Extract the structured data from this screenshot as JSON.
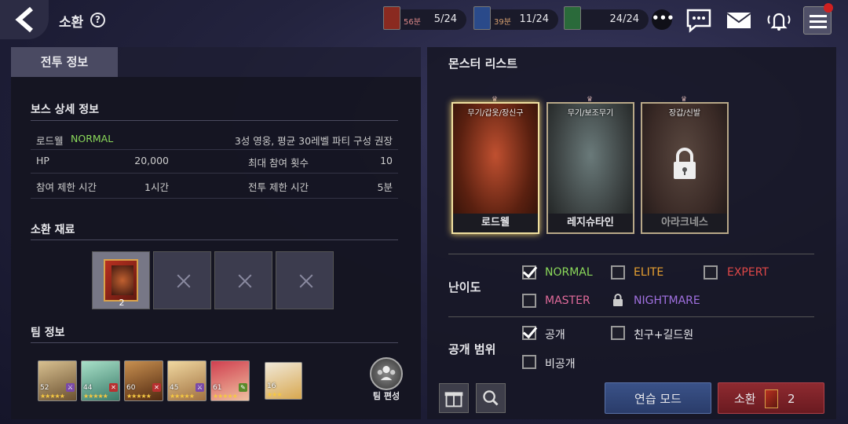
{
  "header": {
    "title": "소환",
    "help": "?"
  },
  "resources": [
    {
      "tag": "56분",
      "value": "5/24",
      "color": "#8a2a20"
    },
    {
      "tag": "39분",
      "value": "11/24",
      "color": "#2a4a8a"
    },
    {
      "tag": "",
      "value": "24/24",
      "color": "#2a6a3a"
    }
  ],
  "more_label": "•••",
  "battle_tab": "전투 정보",
  "boss": {
    "heading": "보스 상세 정보",
    "name": "로드웰",
    "difficulty": "NORMAL",
    "recommendation": "3성 영웅, 평균 30레벨 파티 구성 권장",
    "hp_label": "HP",
    "hp_value": "20,000",
    "max_join_label": "최대 참여 횟수",
    "max_join_value": "10",
    "join_time_label": "참여 제한 시간",
    "join_time_value": "1시간",
    "battle_time_label": "전투 제한 시간",
    "battle_time_value": "5분"
  },
  "materials": {
    "heading": "소환 재료",
    "count": "2"
  },
  "team": {
    "heading": "팀 정보",
    "edit_label": "팀 편성",
    "heroes": [
      {
        "level": "52",
        "stars": "★★★★★",
        "cls_color": "#7a4aa8",
        "cls": "⚔"
      },
      {
        "level": "44",
        "stars": "★★★★★",
        "cls_color": "#b83030",
        "cls": "✕"
      },
      {
        "level": "60",
        "stars": "★★★★★",
        "cls_color": "#b83030",
        "cls": "✕"
      },
      {
        "level": "45",
        "stars": "★★★★★",
        "cls_color": "#7a4aa8",
        "cls": "⚔"
      },
      {
        "level": "61",
        "stars": "★★★★★",
        "cls_color": "#5a8a2a",
        "cls": "✎"
      },
      {
        "level": "16",
        "stars": "★★★",
        "cls_color": "",
        "cls": ""
      }
    ]
  },
  "monsters": {
    "heading": "몬스터 리스트",
    "list": [
      {
        "name": "로드웰",
        "tag": "무기/갑옷/장신구",
        "locked": false
      },
      {
        "name": "레지슈타인",
        "tag": "무기/보조무기",
        "locked": false
      },
      {
        "name": "아라크네스",
        "tag": "장갑/신발",
        "locked": true
      }
    ]
  },
  "difficulty": {
    "label": "난이도",
    "options": [
      {
        "label": "NORMAL",
        "color": "#8ad85a",
        "checked": true
      },
      {
        "label": "ELITE",
        "color": "#e8a030",
        "checked": false
      },
      {
        "label": "EXPERT",
        "color": "#e04848",
        "checked": false
      },
      {
        "label": "MASTER",
        "color": "#e06a9a",
        "checked": false
      },
      {
        "label": "NIGHTMARE",
        "color": "#a070e0",
        "checked": false,
        "locked": true
      }
    ]
  },
  "visibility": {
    "label": "공개 범위",
    "options": [
      {
        "label": "공개",
        "checked": true
      },
      {
        "label": "친구+길드원",
        "checked": false
      },
      {
        "label": "비공개",
        "checked": false
      }
    ]
  },
  "actions": {
    "practice": "연습 모드",
    "summon": "소환",
    "summon_count": "2"
  }
}
